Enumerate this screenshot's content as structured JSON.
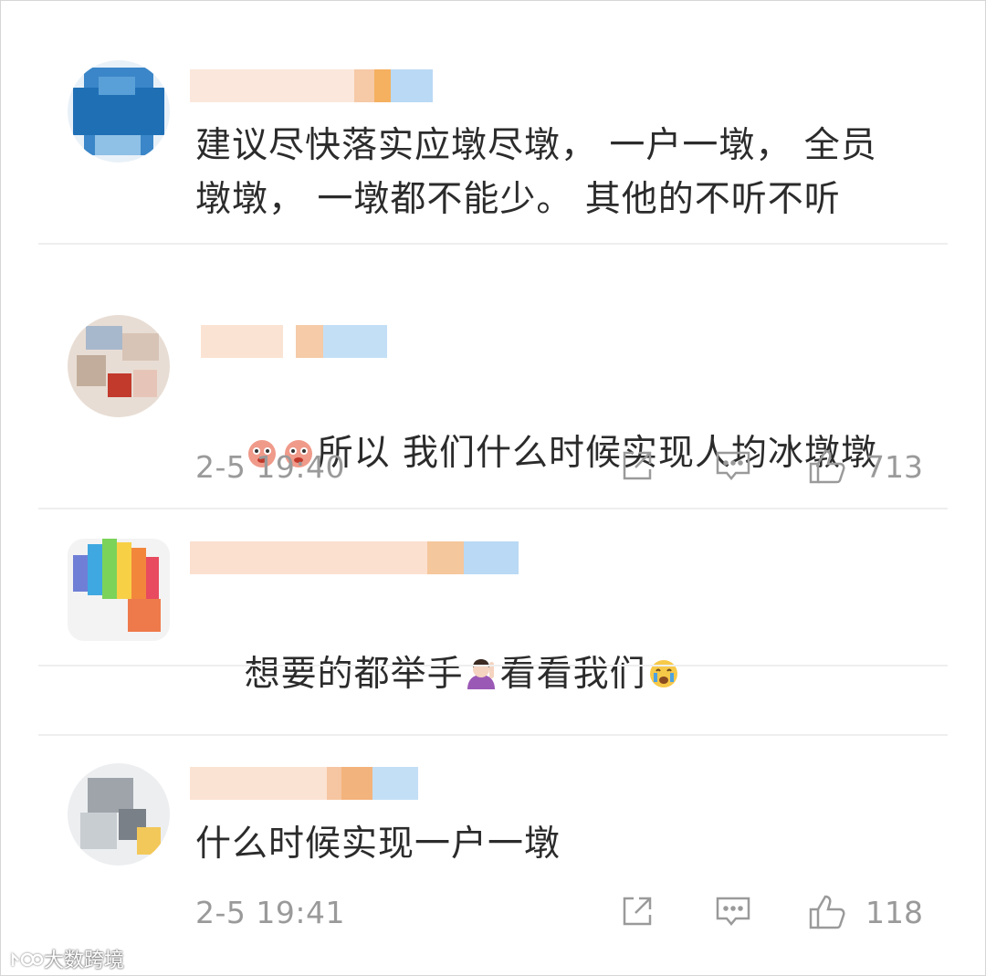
{
  "comments": [
    {
      "text": "建议尽快落实应墩尽墩， 一户一墩， 全员墩墩， 一墩都不能少。 其他的不听不听"
    },
    {
      "text": "所以 我们什么时候实现人均冰墩墩",
      "time": "2-5 19:40",
      "likes": "713",
      "share_icon": "share-icon",
      "reply_icon": "comment-icon",
      "like_icon": "thumbs-up-icon"
    },
    {
      "text_before": "想要的都举手",
      "text_after": "看看我们"
    },
    {
      "text": "什么时候实现一户一墩",
      "time": "2-5 19:41",
      "likes": "118",
      "share_icon": "share-icon",
      "reply_icon": "comment-icon",
      "like_icon": "thumbs-up-icon"
    }
  ],
  "watermark": "大数跨境",
  "colors": {
    "text": "#2b2b2b",
    "meta": "#9a9a9a",
    "divider": "#eeeeee"
  }
}
